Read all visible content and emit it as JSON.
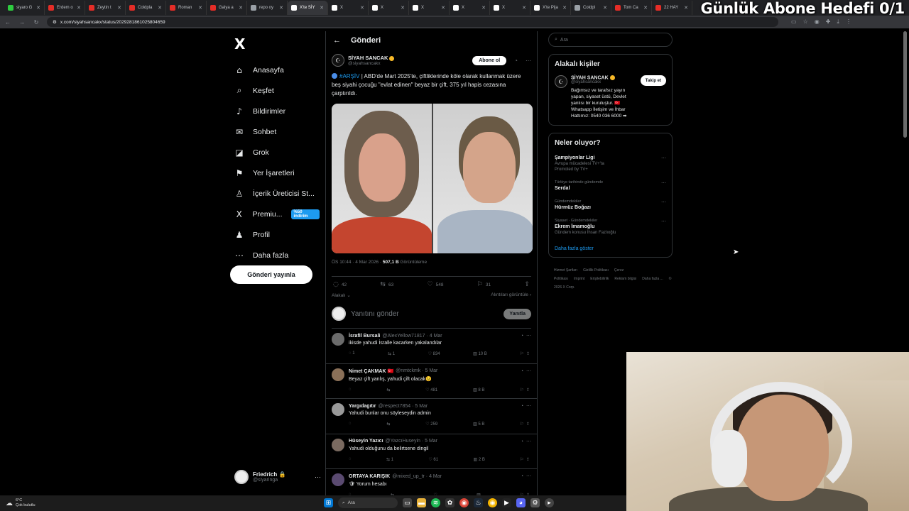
{
  "overlay": {
    "title": "Günlük Abone Hedefi 0/1"
  },
  "browser": {
    "tabs": [
      {
        "label": "siyaro G",
        "color": "#2ecc40"
      },
      {
        "label": "Erdem o",
        "color": "#e52d27"
      },
      {
        "label": "Zeytin t",
        "color": "#e52d27"
      },
      {
        "label": "Coldpla",
        "color": "#e52d27"
      },
      {
        "label": "Roman",
        "color": "#e52d27"
      },
      {
        "label": "Galya a",
        "color": "#e52d27"
      },
      {
        "label": "repo oy",
        "color": "#9aa0a6"
      },
      {
        "label": "X'te SİY",
        "color": "#ffffff",
        "active": true
      },
      {
        "label": "X",
        "color": "#ffffff"
      },
      {
        "label": "X",
        "color": "#ffffff"
      },
      {
        "label": "X",
        "color": "#ffffff"
      },
      {
        "label": "X",
        "color": "#ffffff"
      },
      {
        "label": "X",
        "color": "#ffffff"
      },
      {
        "label": "X'te Pija",
        "color": "#ffffff"
      },
      {
        "label": "Coldpl",
        "color": "#9aa0a6"
      },
      {
        "label": "Tom Ca",
        "color": "#e52d27"
      },
      {
        "label": "22 HAY",
        "color": "#e52d27"
      }
    ],
    "url": "x.com/siyahsancakx/status/2029281861025804659"
  },
  "nav": {
    "logo": "X",
    "items": [
      {
        "icon": "⌂",
        "label": "Anasayfa",
        "name": "home"
      },
      {
        "icon": "⌕",
        "label": "Keşfet",
        "name": "explore"
      },
      {
        "icon": "♪",
        "label": "Bildirimler",
        "name": "notifications"
      },
      {
        "icon": "✉",
        "label": "Sohbet",
        "name": "chat"
      },
      {
        "icon": "◪",
        "label": "Grok",
        "name": "grok"
      },
      {
        "icon": "⚑",
        "label": "Yer İşaretleri",
        "name": "bookmarks"
      },
      {
        "icon": "♙",
        "label": "İçerik Üreticisi St...",
        "name": "creator-studio"
      },
      {
        "icon": "X",
        "label": "Premiu...",
        "name": "premium",
        "badge": "%50 indirim"
      },
      {
        "icon": "♟",
        "label": "Profil",
        "name": "profile"
      },
      {
        "icon": "⋯",
        "label": "Daha fazla",
        "name": "more"
      }
    ],
    "post_button": "Gönderi yayınla",
    "account": {
      "name": "Friedrich 🔒",
      "handle": "@siyaringa"
    }
  },
  "post": {
    "header": "Gönderi",
    "author": "SİYAH SANCAK",
    "handle": "@siyahsancakx",
    "follow": "Abone ol",
    "tag": "#ARŞİV",
    "text": " | ABD'de Mart 2025'te, çiftliklerinde köle olarak kullanmak üzere beş siyahi çocuğu \"evlat edinen\" beyaz bir çift, 375 yıl hapis cezasına çarptırıldı.",
    "time": "ÖS 10:44 · 4 Mar 2026 · ",
    "views": "507,1 B",
    "views_label": " Görüntüleme",
    "replies": "42",
    "reposts": "63",
    "likes": "548",
    "bookmarks": "31",
    "relevance": "Alakalı ⌄",
    "show_views": "Alıntıları görüntüle ›",
    "reply_placeholder": "Yanıtını gönder",
    "reply_button": "Yanıtla"
  },
  "replies": [
    {
      "name": "İsrafil Bursali",
      "handle": "@AlexYellow71817 · 4 Mar",
      "text": "ikisde yahudi İsralle kacarken yakalandılar",
      "r": "1",
      "rt": "1",
      "l": "834",
      "v": "10 B",
      "color": "#6b6b6b"
    },
    {
      "name": "Nimet ÇAKMAK 🇹🇷",
      "handle": "@nmtckmk · 5 Mar",
      "text": "Beyaz çift yanlış, yahudi çift olacak😉",
      "r": "",
      "rt": "",
      "l": "481",
      "v": "8 B",
      "color": "#8a7058"
    },
    {
      "name": "Yargıdagıtır",
      "handle": "@respect7854 · 5 Mar",
      "text": "Yahudi bunlar onu söyleseydin admin",
      "r": "",
      "rt": "",
      "l": "259",
      "v": "5 B",
      "color": "#999999"
    },
    {
      "name": "Hüseyin Yazıcı",
      "handle": "@YazcıHuseyin · 5 Mar",
      "text": "Yahudi olduğunu da belirtsene dingil",
      "r": "",
      "rt": "1",
      "l": "61",
      "v": "2 B",
      "color": "#7a6a60"
    },
    {
      "name": "ORTAYA KARIŞIK",
      "handle": "@mixed_up_tr · 4 Mar",
      "text": "🛡 Yorum hesabı",
      "r": "",
      "rt": "",
      "l": "",
      "v": "",
      "color": "#5a4a70"
    }
  ],
  "right": {
    "search_placeholder": "Ara",
    "related_title": "Alakalı kişiler",
    "related": {
      "name": "SİYAH SANCAK",
      "handle": "@siyahsancakx",
      "follow": "Takip et",
      "bio": "Bağımsız ve tarafsız yayın yapan, siyaset üstü, Devlet yanlısı bir kuruluştur. 🇹🇷 Whatsapp İletişim ve İhbar Hattımız: 0540 036 6000 ➡"
    },
    "trends_title": "Neler oluyor?",
    "trends": [
      {
        "cat": "",
        "title": "Şampiyonlar Ligi",
        "sub": "Avrupa mücadelesi TV+'ta",
        "sub2": "Promoted by TV+"
      },
      {
        "cat": "Türkiye tarihinde gündemde",
        "title": "Serdal",
        "sub": "",
        "sub2": ""
      },
      {
        "cat": "Gündemdekiler",
        "title": "Hürmüz Boğazı",
        "sub": "",
        "sub2": ""
      },
      {
        "cat": "Siyaset · Gündemdekiler",
        "title": "Ekrem İmamoğlu",
        "sub": "Gündem konusu İhsan Fazlıoğlu",
        "sub2": ""
      }
    ],
    "show_more": "Daha fazla göster",
    "footer": [
      "Hizmet Şartları",
      "Gizlilik Politikası",
      "Çerez Politikası",
      "Imprint",
      "Erişilebilirlik",
      "Reklam bilgisi",
      "Daha fazla ...",
      "© 2026 X Corp."
    ]
  },
  "taskbar": {
    "weather_temp": "6°C",
    "weather_desc": "Çok bulutlu",
    "search": "Ara"
  }
}
